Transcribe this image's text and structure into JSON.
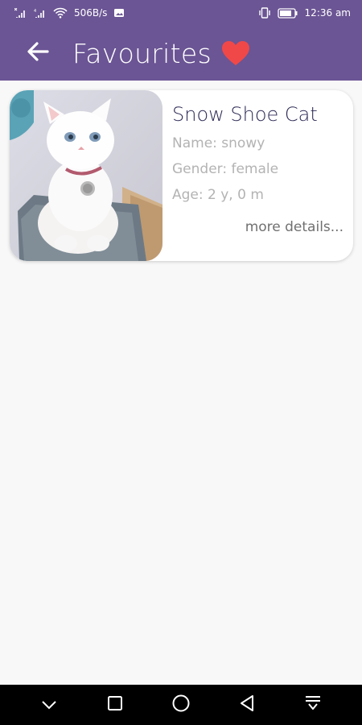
{
  "status_bar": {
    "network_speed": "506B/s",
    "time": "12:36 am",
    "icons": [
      "signal-x-icon",
      "signal-icon",
      "wifi-icon",
      "data-speed",
      "image-notification-icon",
      "vibrate-icon",
      "battery-icon"
    ]
  },
  "header": {
    "title": "Favourites",
    "back_icon": "arrow-left-icon",
    "heart_icon": "heart-icon"
  },
  "favourites": [
    {
      "breed": "Snow Shoe Cat",
      "name": "Name: snowy",
      "gender": "Gender: female",
      "age": "Age: 2 y, 0 m",
      "more_link": "more details..."
    }
  ],
  "nav_bar": {
    "icons": [
      "chevron-down-icon",
      "square-icon",
      "circle-icon",
      "triangle-back-icon",
      "notification-pull-icon"
    ]
  },
  "colors": {
    "primary": "#6b5594",
    "heart": "#f04848",
    "breed_text": "#2d2a55",
    "field_text": "#b3b3b3",
    "background": "#f8f8f8"
  }
}
